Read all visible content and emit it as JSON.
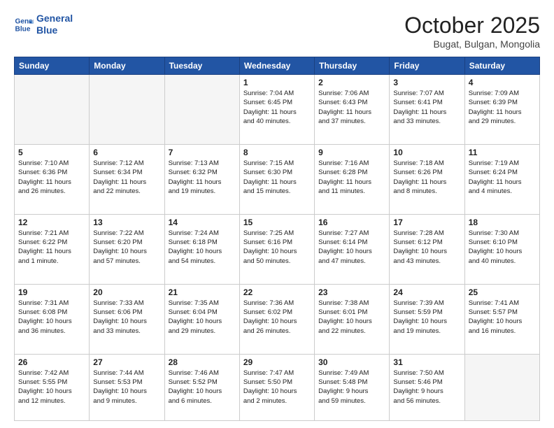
{
  "header": {
    "logo_line1": "General",
    "logo_line2": "Blue",
    "month_title": "October 2025",
    "location": "Bugat, Bulgan, Mongolia"
  },
  "weekdays": [
    "Sunday",
    "Monday",
    "Tuesday",
    "Wednesday",
    "Thursday",
    "Friday",
    "Saturday"
  ],
  "weeks": [
    [
      {
        "day": "",
        "info": ""
      },
      {
        "day": "",
        "info": ""
      },
      {
        "day": "",
        "info": ""
      },
      {
        "day": "1",
        "info": "Sunrise: 7:04 AM\nSunset: 6:45 PM\nDaylight: 11 hours\nand 40 minutes."
      },
      {
        "day": "2",
        "info": "Sunrise: 7:06 AM\nSunset: 6:43 PM\nDaylight: 11 hours\nand 37 minutes."
      },
      {
        "day": "3",
        "info": "Sunrise: 7:07 AM\nSunset: 6:41 PM\nDaylight: 11 hours\nand 33 minutes."
      },
      {
        "day": "4",
        "info": "Sunrise: 7:09 AM\nSunset: 6:39 PM\nDaylight: 11 hours\nand 29 minutes."
      }
    ],
    [
      {
        "day": "5",
        "info": "Sunrise: 7:10 AM\nSunset: 6:36 PM\nDaylight: 11 hours\nand 26 minutes."
      },
      {
        "day": "6",
        "info": "Sunrise: 7:12 AM\nSunset: 6:34 PM\nDaylight: 11 hours\nand 22 minutes."
      },
      {
        "day": "7",
        "info": "Sunrise: 7:13 AM\nSunset: 6:32 PM\nDaylight: 11 hours\nand 19 minutes."
      },
      {
        "day": "8",
        "info": "Sunrise: 7:15 AM\nSunset: 6:30 PM\nDaylight: 11 hours\nand 15 minutes."
      },
      {
        "day": "9",
        "info": "Sunrise: 7:16 AM\nSunset: 6:28 PM\nDaylight: 11 hours\nand 11 minutes."
      },
      {
        "day": "10",
        "info": "Sunrise: 7:18 AM\nSunset: 6:26 PM\nDaylight: 11 hours\nand 8 minutes."
      },
      {
        "day": "11",
        "info": "Sunrise: 7:19 AM\nSunset: 6:24 PM\nDaylight: 11 hours\nand 4 minutes."
      }
    ],
    [
      {
        "day": "12",
        "info": "Sunrise: 7:21 AM\nSunset: 6:22 PM\nDaylight: 11 hours\nand 1 minute."
      },
      {
        "day": "13",
        "info": "Sunrise: 7:22 AM\nSunset: 6:20 PM\nDaylight: 10 hours\nand 57 minutes."
      },
      {
        "day": "14",
        "info": "Sunrise: 7:24 AM\nSunset: 6:18 PM\nDaylight: 10 hours\nand 54 minutes."
      },
      {
        "day": "15",
        "info": "Sunrise: 7:25 AM\nSunset: 6:16 PM\nDaylight: 10 hours\nand 50 minutes."
      },
      {
        "day": "16",
        "info": "Sunrise: 7:27 AM\nSunset: 6:14 PM\nDaylight: 10 hours\nand 47 minutes."
      },
      {
        "day": "17",
        "info": "Sunrise: 7:28 AM\nSunset: 6:12 PM\nDaylight: 10 hours\nand 43 minutes."
      },
      {
        "day": "18",
        "info": "Sunrise: 7:30 AM\nSunset: 6:10 PM\nDaylight: 10 hours\nand 40 minutes."
      }
    ],
    [
      {
        "day": "19",
        "info": "Sunrise: 7:31 AM\nSunset: 6:08 PM\nDaylight: 10 hours\nand 36 minutes."
      },
      {
        "day": "20",
        "info": "Sunrise: 7:33 AM\nSunset: 6:06 PM\nDaylight: 10 hours\nand 33 minutes."
      },
      {
        "day": "21",
        "info": "Sunrise: 7:35 AM\nSunset: 6:04 PM\nDaylight: 10 hours\nand 29 minutes."
      },
      {
        "day": "22",
        "info": "Sunrise: 7:36 AM\nSunset: 6:02 PM\nDaylight: 10 hours\nand 26 minutes."
      },
      {
        "day": "23",
        "info": "Sunrise: 7:38 AM\nSunset: 6:01 PM\nDaylight: 10 hours\nand 22 minutes."
      },
      {
        "day": "24",
        "info": "Sunrise: 7:39 AM\nSunset: 5:59 PM\nDaylight: 10 hours\nand 19 minutes."
      },
      {
        "day": "25",
        "info": "Sunrise: 7:41 AM\nSunset: 5:57 PM\nDaylight: 10 hours\nand 16 minutes."
      }
    ],
    [
      {
        "day": "26",
        "info": "Sunrise: 7:42 AM\nSunset: 5:55 PM\nDaylight: 10 hours\nand 12 minutes."
      },
      {
        "day": "27",
        "info": "Sunrise: 7:44 AM\nSunset: 5:53 PM\nDaylight: 10 hours\nand 9 minutes."
      },
      {
        "day": "28",
        "info": "Sunrise: 7:46 AM\nSunset: 5:52 PM\nDaylight: 10 hours\nand 6 minutes."
      },
      {
        "day": "29",
        "info": "Sunrise: 7:47 AM\nSunset: 5:50 PM\nDaylight: 10 hours\nand 2 minutes."
      },
      {
        "day": "30",
        "info": "Sunrise: 7:49 AM\nSunset: 5:48 PM\nDaylight: 9 hours\nand 59 minutes."
      },
      {
        "day": "31",
        "info": "Sunrise: 7:50 AM\nSunset: 5:46 PM\nDaylight: 9 hours\nand 56 minutes."
      },
      {
        "day": "",
        "info": ""
      }
    ]
  ]
}
